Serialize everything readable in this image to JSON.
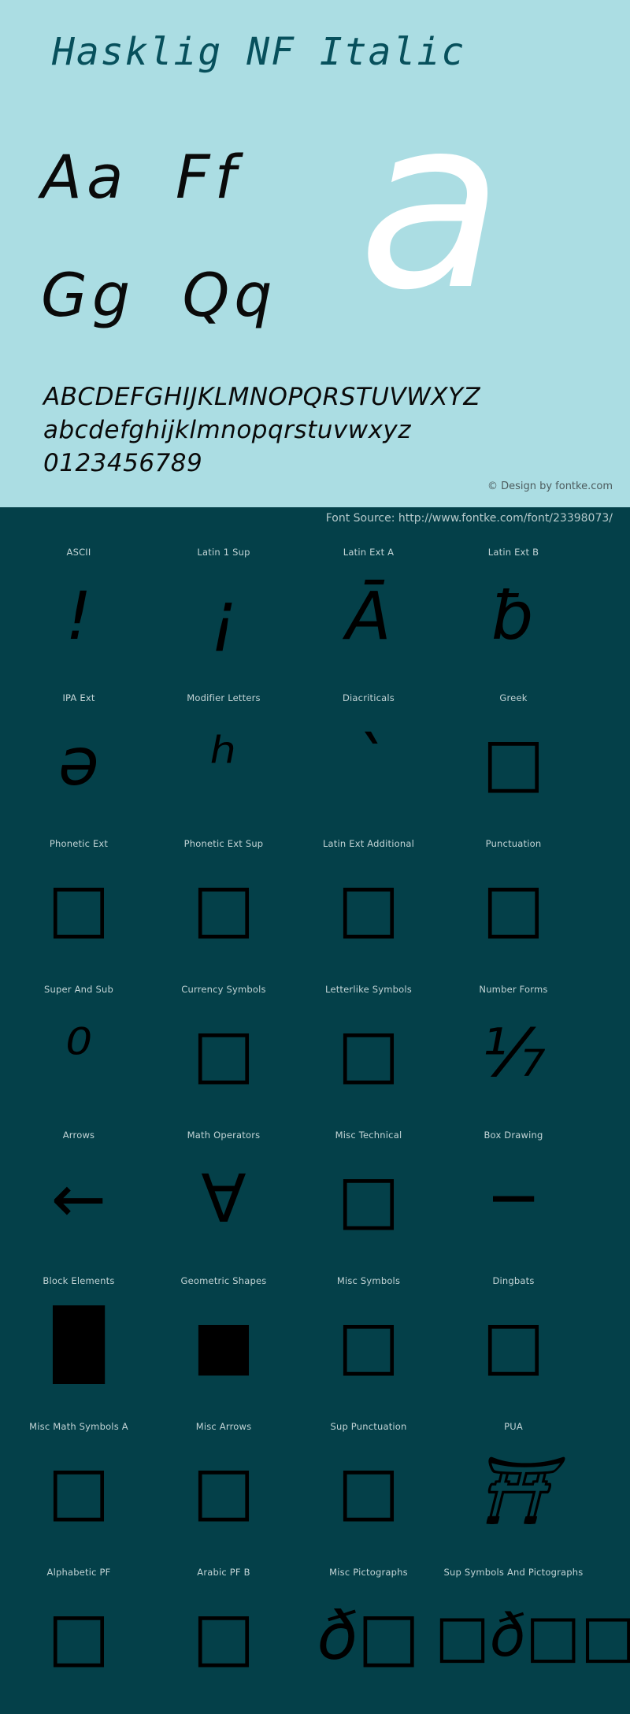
{
  "header": {
    "title": "Hasklig NF Italic",
    "sample_pairs": "Aa  Ff\nGg  Qq",
    "big_glyph": "a",
    "uppercase": "ABCDEFGHIJKLMNOPQRSTUVWXYZ",
    "lowercase": "abcdefghijklmnopqrstuvwxyz",
    "digits": "0123456789",
    "copyright": "© Design by fontke.com",
    "background": "#abdde3",
    "title_color": "#07505c",
    "big_glyph_color": "#ffffff"
  },
  "body": {
    "font_source": "Font Source: http://www.fontke.com/font/23398073/",
    "background": "#044049",
    "label_color": "#c3d4d6",
    "glyph_color": "#000000"
  },
  "unicode_blocks": [
    [
      {
        "label": "ASCII",
        "glyph": "!"
      },
      {
        "label": "Latin 1 Sup",
        "glyph": "¡"
      },
      {
        "label": "Latin Ext A",
        "glyph": "Ā"
      },
      {
        "label": "Latin Ext B",
        "glyph": "ƀ"
      }
    ],
    [
      {
        "label": "IPA Ext",
        "glyph": "ǝ"
      },
      {
        "label": "Modifier Letters",
        "glyph": "ʰ"
      },
      {
        "label": "Diacriticals",
        "glyph": "`"
      },
      {
        "label": "Greek",
        "glyph": "□"
      }
    ],
    [
      {
        "label": "Phonetic Ext",
        "glyph": "□"
      },
      {
        "label": "Phonetic Ext Sup",
        "glyph": "□"
      },
      {
        "label": "Latin Ext Additional",
        "glyph": "□"
      },
      {
        "label": "Punctuation",
        "glyph": "□"
      }
    ],
    [
      {
        "label": "Super And Sub",
        "glyph": "⁰"
      },
      {
        "label": "Currency Symbols",
        "glyph": "□"
      },
      {
        "label": "Letterlike Symbols",
        "glyph": "□"
      },
      {
        "label": "Number Forms",
        "glyph": "⅐"
      }
    ],
    [
      {
        "label": "Arrows",
        "glyph": "←"
      },
      {
        "label": "Math Operators",
        "glyph": "∀"
      },
      {
        "label": "Misc Technical",
        "glyph": "□"
      },
      {
        "label": "Box Drawing",
        "glyph": "─"
      }
    ],
    [
      {
        "label": "Block Elements",
        "glyph": "█"
      },
      {
        "label": "Geometric Shapes",
        "glyph": "■"
      },
      {
        "label": "Misc Symbols",
        "glyph": "□"
      },
      {
        "label": "Dingbats",
        "glyph": "□"
      }
    ],
    [
      {
        "label": "Misc Math Symbols A",
        "glyph": "□"
      },
      {
        "label": "Misc Arrows",
        "glyph": "□"
      },
      {
        "label": "Sup Punctuation",
        "glyph": "□"
      },
      {
        "label": "PUA",
        "glyph": "⛩"
      }
    ],
    [
      {
        "label": "Alphabetic PF",
        "glyph": "□"
      },
      {
        "label": "Arabic PF B",
        "glyph": "□"
      },
      {
        "label": "Misc Pictographs",
        "glyph": "ð□"
      },
      {
        "label": "Sup Symbols And Pictographs",
        "glyph": "□ð□□□ð"
      }
    ]
  ]
}
